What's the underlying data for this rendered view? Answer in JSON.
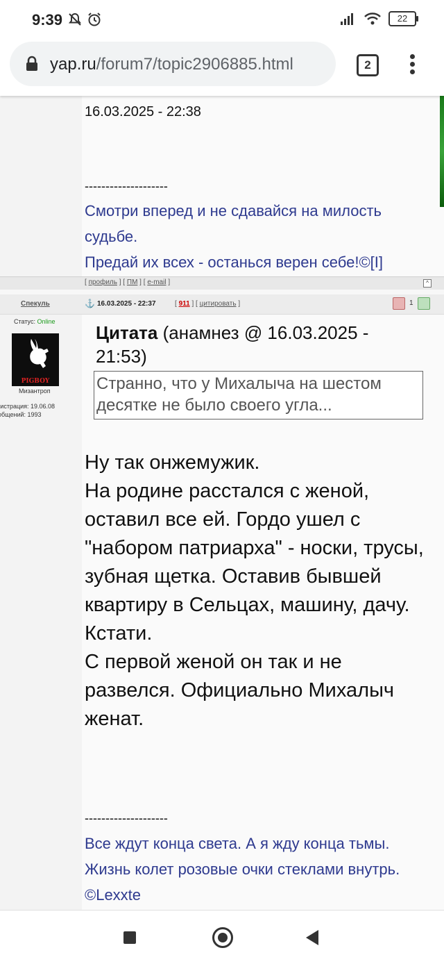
{
  "status_bar": {
    "time": "9:39",
    "battery": "22"
  },
  "browser": {
    "url_host": "yap.ru",
    "url_path": "/forum7/topic2906885.html",
    "tab_count": "2"
  },
  "post1": {
    "date": "16.03.2025 - 22:38",
    "separator": "--------------------",
    "signature_line1": "Смотри вперед и не сдавайся на милость судьбе.",
    "signature_line2": "Предай их всех - останься верен себе!©[I]"
  },
  "links_bar": {
    "profile": "профиль",
    "pm": "ПМ",
    "email": "e-mail"
  },
  "post2": {
    "author": "Спекуль",
    "status_label": "Статус:",
    "status_value": "Online",
    "avatar_caption": "PIGBOY",
    "user_title": "Мизантроп",
    "registration": "егистрация: 19.06.08",
    "messages": "ообщений: 1993",
    "date": "16.03.2025 - 22:37",
    "post_number": "911",
    "quote_link": "цитировать",
    "vote_count": "1",
    "quote_title": "Цитата",
    "quote_meta": "(анамнез @ 16.03.2025 - 21:53)",
    "quote_text": "Странно, что у Михалыча на шестом десятке не было своего угла...",
    "body_lines": [
      "Ну так онжемужик.",
      "На родине расстался с женой, оставил все ей. Гордо ушел с \"набором патриарха\" - носки, трусы, зубная щетка. Оставив бывшей квартиру в Сельцах, машину, дачу.",
      "Кстати.",
      "С первой женой он так и не развелся. Официально Михалыч женат."
    ],
    "separator": "--------------------",
    "signature_line1": "Все ждут конца света. А я жду конца тьмы.",
    "signature_line2": "Жизнь колет розовые очки стеклами внутрь. ©Lexxte"
  }
}
